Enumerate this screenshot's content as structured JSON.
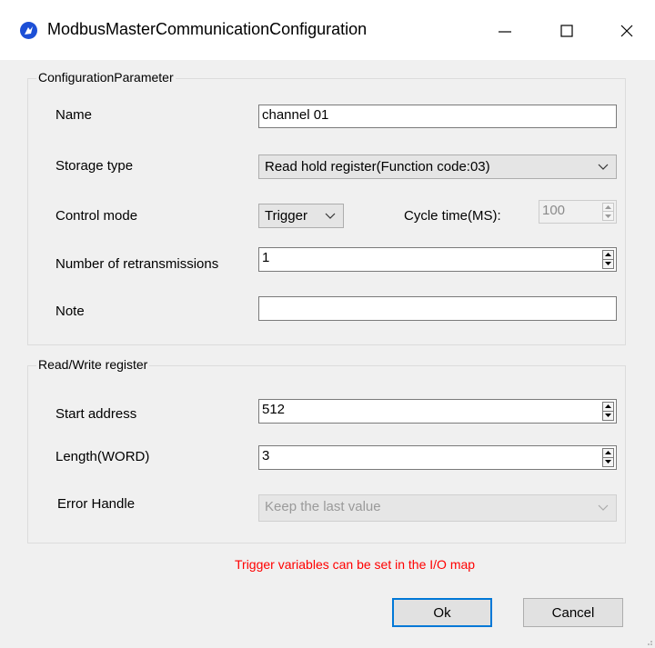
{
  "window": {
    "title": "ModbusMasterCommunicationConfiguration",
    "app_icon": "app-logo-icon",
    "minimize_icon": "minimize-icon",
    "maximize_icon": "maximize-icon",
    "close_icon": "close-icon"
  },
  "config_group": {
    "title": "ConfigurationParameter",
    "name_label": "Name",
    "name_value": "channel 01",
    "storage_label": "Storage type",
    "storage_value": "Read hold register(Function code:03)",
    "control_label": "Control mode",
    "control_value": "Trigger",
    "cycle_label": "Cycle time(MS):",
    "cycle_value": "100",
    "retrans_label": "Number of retransmissions",
    "retrans_value": "1",
    "note_label": "Note",
    "note_value": ""
  },
  "rw_group": {
    "title": "Read/Write register",
    "start_label": "Start address",
    "start_value": "512",
    "length_label": "Length(WORD)",
    "length_value": "3",
    "error_label": "Error Handle",
    "error_value": "Keep the last value"
  },
  "hint": "Trigger variables can be set in the I/O map",
  "buttons": {
    "ok": "Ok",
    "cancel": "Cancel"
  },
  "colors": {
    "hint": "#ff0000",
    "default_button_border": "#0078d7",
    "dialog_bg": "#f0f0f0"
  }
}
